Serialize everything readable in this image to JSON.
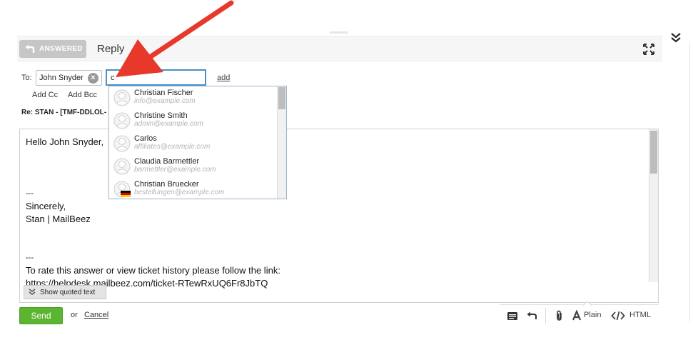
{
  "header": {
    "answered_label": "ANSWERED",
    "title": "Reply"
  },
  "recipients": {
    "to_label": "To:",
    "to_chip": "John Snyder",
    "input_value": "c",
    "add_label": "add",
    "add_cc_label": "Add Cc",
    "add_bcc_label": "Add Bcc"
  },
  "subject": "Re: STAN - [TMF-DDLOL-",
  "suggestions": [
    {
      "name": "Christian Fischer",
      "email": "info@example.com",
      "flag": ""
    },
    {
      "name": "Christine Smith",
      "email": "admin@example.com",
      "flag": ""
    },
    {
      "name": "Carlos",
      "email": "affiliates@example.com",
      "flag": ""
    },
    {
      "name": "Claudia Barmettler",
      "email": "barmettler@example.com",
      "flag": ""
    },
    {
      "name": "Christian Bruecker",
      "email": "bestellungen@example.com",
      "flag": "de-flag"
    }
  ],
  "editor": {
    "greeting": "Hello John Snyder,",
    "dash1": "---",
    "sign_off": "Sincerely,",
    "signature": "Stan | MailBeez",
    "dash2": "---",
    "rate_text": "To rate this answer or view ticket history please follow the link:",
    "link_text": "https://helpdesk.mailbeez.com/ticket-RTewRxUQ6Fr8JbTQ",
    "show_quoted_label": "Show quoted text"
  },
  "footer": {
    "send_label": "Send",
    "or_label": "or",
    "cancel_label": "Cancel",
    "plain_label": "Plain",
    "html_label": "HTML"
  },
  "colors": {
    "send_green": "#5cb531",
    "input_focus_blue": "#4a90c8",
    "arrow_red": "#e8382b",
    "answered_gray": "#c6c6c6"
  }
}
